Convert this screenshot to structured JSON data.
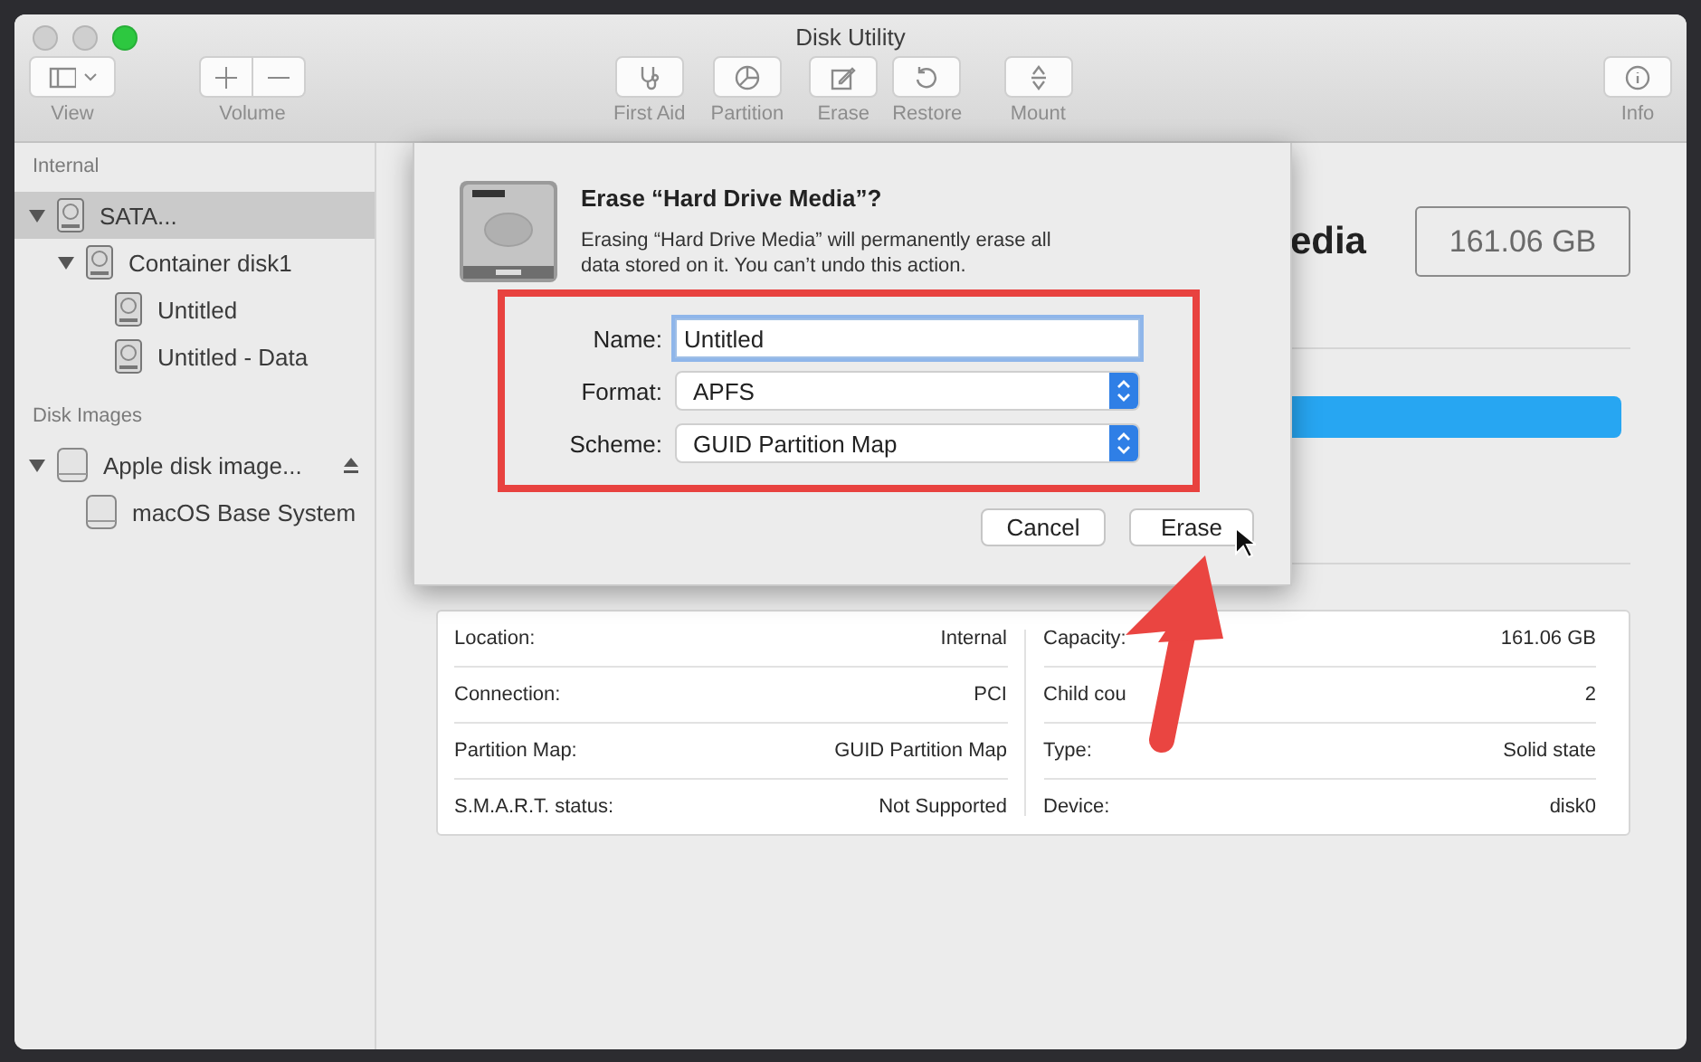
{
  "window": {
    "title": "Disk Utility"
  },
  "toolbar": [
    {
      "label": "View",
      "kind": "view"
    },
    {
      "label": "Volume",
      "kind": "volume"
    },
    {
      "label": "First Aid",
      "kind": "first_aid"
    },
    {
      "label": "Partition",
      "kind": "partition"
    },
    {
      "label": "Erase",
      "kind": "erase"
    },
    {
      "label": "Restore",
      "kind": "restore"
    },
    {
      "label": "Mount",
      "kind": "mount"
    },
    {
      "label": "Info",
      "kind": "info"
    }
  ],
  "sidebar": [
    {
      "heading": "Internal",
      "items": [
        {
          "label": "SATA...",
          "kind": "disk",
          "selected": true,
          "expanded": true,
          "children": [
            {
              "label": "Container disk1",
              "kind": "disk",
              "selected": false,
              "expanded": true,
              "children": [
                {
                  "label": "Untitled",
                  "kind": "disk",
                  "selected": false
                },
                {
                  "label": "Untitled - Data",
                  "kind": "disk",
                  "selected": false
                }
              ]
            }
          ]
        }
      ]
    },
    {
      "heading": "Disk Images",
      "items": [
        {
          "label": "Apple disk image...",
          "kind": "image",
          "selected": false,
          "expanded": true,
          "ejectable": true,
          "children": [
            {
              "label": "macOS Base System",
              "kind": "image",
              "selected": false
            }
          ]
        }
      ]
    }
  ],
  "disk": {
    "title": "edia",
    "capacity": "161.06 GB"
  },
  "info": {
    "left": [
      {
        "label": "Location:",
        "value": "Internal"
      },
      {
        "label": "Connection:",
        "value": "PCI"
      },
      {
        "label": "Partition Map:",
        "value": "GUID Partition Map"
      },
      {
        "label": "S.M.A.R.T. status:",
        "value": "Not Supported"
      }
    ],
    "right": [
      {
        "label": "Capacity:",
        "value": "161.06 GB"
      },
      {
        "label": "Child cou",
        "value": "2"
      },
      {
        "label": "Type:",
        "value": "Solid state"
      },
      {
        "label": "Device:",
        "value": "disk0"
      }
    ]
  },
  "dialog": {
    "title": "Erase “Hard Drive Media”?",
    "message": "Erasing “Hard Drive Media” will permanently erase all data stored on it. You can’t undo this action.",
    "fields": [
      {
        "label": "Name:",
        "value": "Untitled",
        "kind": "text"
      },
      {
        "label": "Format:",
        "value": "APFS",
        "kind": "popup"
      },
      {
        "label": "Scheme:",
        "value": "GUID Partition Map",
        "kind": "popup"
      }
    ],
    "buttons": [
      {
        "label": "Cancel"
      },
      {
        "label": "Erase"
      }
    ]
  }
}
